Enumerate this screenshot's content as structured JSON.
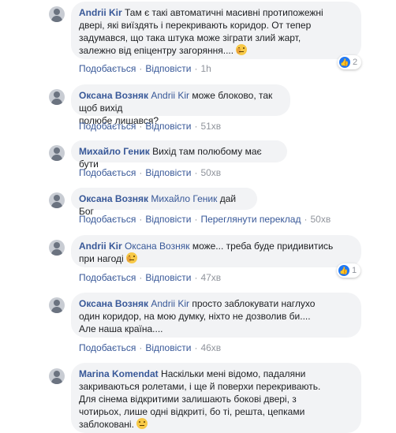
{
  "actions": {
    "like": "Подобається",
    "reply": "Відповісти",
    "see_translation": "Переглянути переклад"
  },
  "comments": [
    {
      "author": "Andrii Kir",
      "mention": "",
      "lines": [
        "Там є такі автоматичні масивні протипожежні",
        "двері, які виїздять і перекривають коридор. От тепер",
        "задумався, що така штука може зіграти злий жарт,",
        "залежно від епіцентру загоряння...."
      ],
      "emoji": "thinking",
      "time": "1h",
      "reactions": "2"
    },
    {
      "author": "Оксана Возняк",
      "mention": "Andrii Kir",
      "lines": [
        "може блоково, так щоб вихід",
        "полюбе лишався?"
      ],
      "time": "51хв"
    },
    {
      "author": "Михайло Геник",
      "mention": "",
      "lines": [
        "Вихід там полюбому має бути"
      ],
      "time": "50хв"
    },
    {
      "author": "Оксана Возняк",
      "mention": "Михайло Геник",
      "lines": [
        "дай Бог"
      ],
      "time": "50хв"
    },
    {
      "author": "Andrii Kir",
      "mention": "Оксана Возняк",
      "lines": [
        "може... треба буде придивитись",
        "при нагоді"
      ],
      "emoji": "thinking",
      "time": "47хв",
      "reactions": "1"
    },
    {
      "author": "Оксана Возняк",
      "mention": "Andrii Kir",
      "lines": [
        "просто заблокувати наглухо",
        "один коридор, на мою думку, ніхто не дозволив би....",
        "Але наша країна...."
      ],
      "time": "46хв"
    },
    {
      "author": "Marina Komendat",
      "mention": "",
      "lines": [
        "Наскільки мені відомо, падаляни",
        "закриваються ролетами, і ще й поверхи перекривають.",
        "Для сінема відкритими залишають бокові двері, з",
        "чотирьох, лише одні відкриті, бо ті, решта, цепками",
        "заблоковані."
      ],
      "emoji": "confused"
    }
  ]
}
